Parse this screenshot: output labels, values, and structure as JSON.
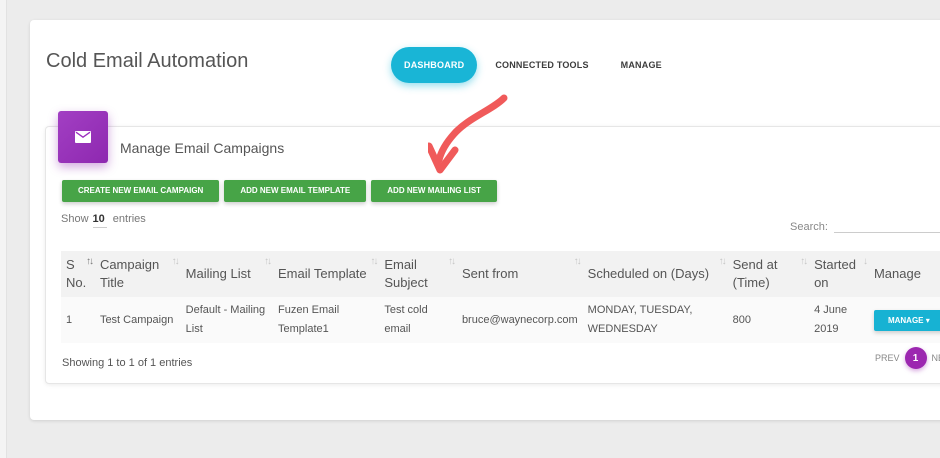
{
  "app": {
    "title": "Cold Email Automation"
  },
  "nav": {
    "tabs": [
      {
        "label": "DASHBOARD"
      },
      {
        "label": "CONNECTED TOOLS"
      },
      {
        "label": "MANAGE"
      }
    ]
  },
  "card": {
    "title": "Manage Email Campaigns",
    "icon": "envelope-icon",
    "accent_color": "#9c27b0"
  },
  "actions": {
    "create_campaign": "CREATE NEW EMAIL CAMPAIGN",
    "add_template": "ADD NEW EMAIL TEMPLATE",
    "add_mailing_list": "ADD NEW MAILING LIST",
    "button_color": "#47a447"
  },
  "length_control": {
    "prefix": "Show",
    "value": "10",
    "suffix": "entries"
  },
  "search": {
    "label": "Search:",
    "value": ""
  },
  "table": {
    "headers": [
      "S No.",
      "Campaign Title",
      "Mailing List",
      "Email Template",
      "Email Subject",
      "Sent from",
      "Scheduled on (Days)",
      "Send at (Time)",
      "Started on",
      "Manage"
    ],
    "rows": [
      {
        "sno": "1",
        "title": "Test Campaign",
        "mailing_list": "Default - Mailing List",
        "template": "Fuzen Email Template1",
        "subject": "Test cold email",
        "sent_from": "bruce@waynecorp.com",
        "scheduled": "MONDAY, TUESDAY, WEDNESDAY",
        "send_at": "800",
        "started": "4 June 2019",
        "manage_label": "MANAGE"
      }
    ]
  },
  "footer": {
    "info": "Showing 1 to 1 of 1 entries",
    "prev": "PREV",
    "page": "1",
    "next": "NE"
  }
}
